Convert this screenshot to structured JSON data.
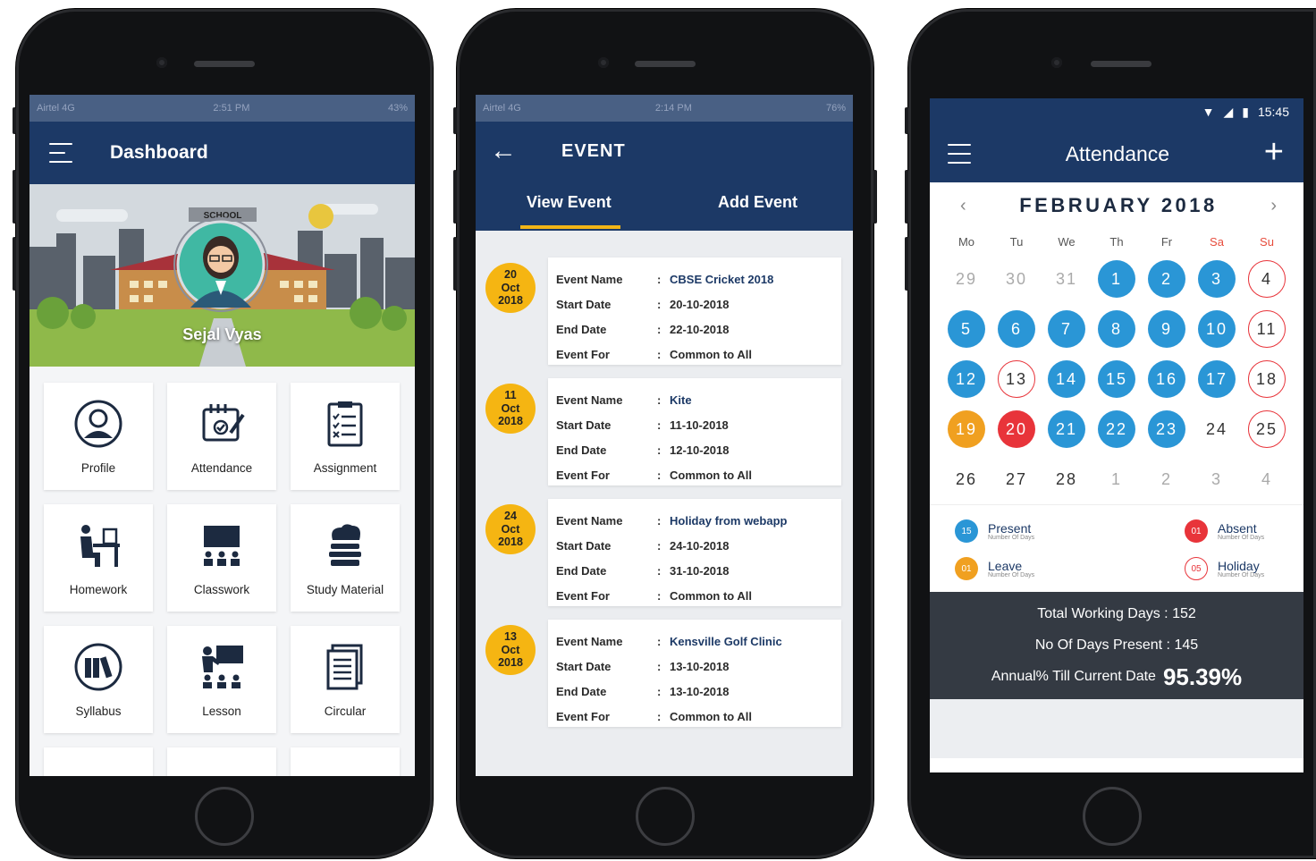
{
  "dashboard": {
    "status": {
      "carrier": "Airtel 4G",
      "time": "2:51 PM",
      "battery": "43%"
    },
    "title": "Dashboard",
    "banner_sign": "SCHOOL",
    "user_name": "Sejal Vyas",
    "tiles": [
      {
        "label": "Profile",
        "icon": "profile-icon"
      },
      {
        "label": "Attendance",
        "icon": "attendance-icon"
      },
      {
        "label": "Assignment",
        "icon": "assignment-icon"
      },
      {
        "label": "Homework",
        "icon": "homework-icon"
      },
      {
        "label": "Classwork",
        "icon": "classwork-icon"
      },
      {
        "label": "Study Material",
        "icon": "study-material-icon"
      },
      {
        "label": "Syllabus",
        "icon": "syllabus-icon"
      },
      {
        "label": "Lesson",
        "icon": "lesson-icon"
      },
      {
        "label": "Circular",
        "icon": "circular-icon"
      }
    ]
  },
  "event": {
    "status": {
      "carrier": "Airtel 4G",
      "time": "2:14 PM",
      "battery": "76%"
    },
    "title": "EVENT",
    "tabs": {
      "view": "View Event",
      "add": "Add Event"
    },
    "labels": {
      "name": "Event Name",
      "start": "Start Date",
      "end": "End Date",
      "for": "Event For",
      "colon": ":"
    },
    "items": [
      {
        "day": "20",
        "month": "Oct",
        "year": "2018",
        "name": "CBSE Cricket 2018",
        "start": "20-10-2018",
        "end": "22-10-2018",
        "for": "Common to All"
      },
      {
        "day": "11",
        "month": "Oct",
        "year": "2018",
        "name": "Kite",
        "start": "11-10-2018",
        "end": "12-10-2018",
        "for": "Common to All"
      },
      {
        "day": "24",
        "month": "Oct",
        "year": "2018",
        "name": "Holiday from webapp",
        "start": "24-10-2018",
        "end": "31-10-2018",
        "for": "Common to All"
      },
      {
        "day": "13",
        "month": "Oct",
        "year": "2018",
        "name": "Kensville Golf Clinic",
        "start": "13-10-2018",
        "end": "13-10-2018",
        "for": "Common to All"
      }
    ]
  },
  "attendance": {
    "status": {
      "time": "15:45"
    },
    "title": "Attendance",
    "month": "FEBRUARY 2018",
    "weekdays": [
      "Mo",
      "Tu",
      "We",
      "Th",
      "Fr",
      "Sa",
      "Su"
    ],
    "days": [
      {
        "n": "29",
        "s": "muted"
      },
      {
        "n": "30",
        "s": "muted"
      },
      {
        "n": "31",
        "s": "muted"
      },
      {
        "n": "1",
        "s": "present"
      },
      {
        "n": "2",
        "s": "present"
      },
      {
        "n": "3",
        "s": "present"
      },
      {
        "n": "4",
        "s": "holiday"
      },
      {
        "n": "5",
        "s": "present"
      },
      {
        "n": "6",
        "s": "present"
      },
      {
        "n": "7",
        "s": "present"
      },
      {
        "n": "8",
        "s": "present"
      },
      {
        "n": "9",
        "s": "present"
      },
      {
        "n": "10",
        "s": "present"
      },
      {
        "n": "11",
        "s": "holiday"
      },
      {
        "n": "12",
        "s": "present"
      },
      {
        "n": "13",
        "s": "holiday"
      },
      {
        "n": "14",
        "s": "present"
      },
      {
        "n": "15",
        "s": "present"
      },
      {
        "n": "16",
        "s": "present"
      },
      {
        "n": "17",
        "s": "present"
      },
      {
        "n": "18",
        "s": "holiday"
      },
      {
        "n": "19",
        "s": "leave"
      },
      {
        "n": "20",
        "s": "absent"
      },
      {
        "n": "21",
        "s": "present"
      },
      {
        "n": "22",
        "s": "present"
      },
      {
        "n": "23",
        "s": "present"
      },
      {
        "n": "24",
        "s": "normal"
      },
      {
        "n": "25",
        "s": "holiday"
      },
      {
        "n": "26",
        "s": "normal"
      },
      {
        "n": "27",
        "s": "normal"
      },
      {
        "n": "28",
        "s": "normal"
      },
      {
        "n": "1",
        "s": "muted"
      },
      {
        "n": "2",
        "s": "muted"
      },
      {
        "n": "3",
        "s": "muted"
      },
      {
        "n": "4",
        "s": "muted"
      }
    ],
    "legend": {
      "present": {
        "count": "15",
        "label": "Present",
        "sub": "Number Of Days"
      },
      "absent": {
        "count": "01",
        "label": "Absent",
        "sub": "Number Of Days"
      },
      "leave": {
        "count": "01",
        "label": "Leave",
        "sub": "Number Of Days"
      },
      "holiday": {
        "count": "05",
        "label": "Holiday",
        "sub": "Number Of Days"
      }
    },
    "summary": {
      "working_label": "Total Working Days :",
      "working": "152",
      "present_label": "No Of Days Present :",
      "present": "145",
      "annual_label": "Annual% Till Current Date",
      "annual": "95.39%"
    },
    "colors": {
      "present": "#2a96d6",
      "absent": "#e8343a",
      "leave": "#f0a020",
      "navy": "#1c3966"
    }
  }
}
